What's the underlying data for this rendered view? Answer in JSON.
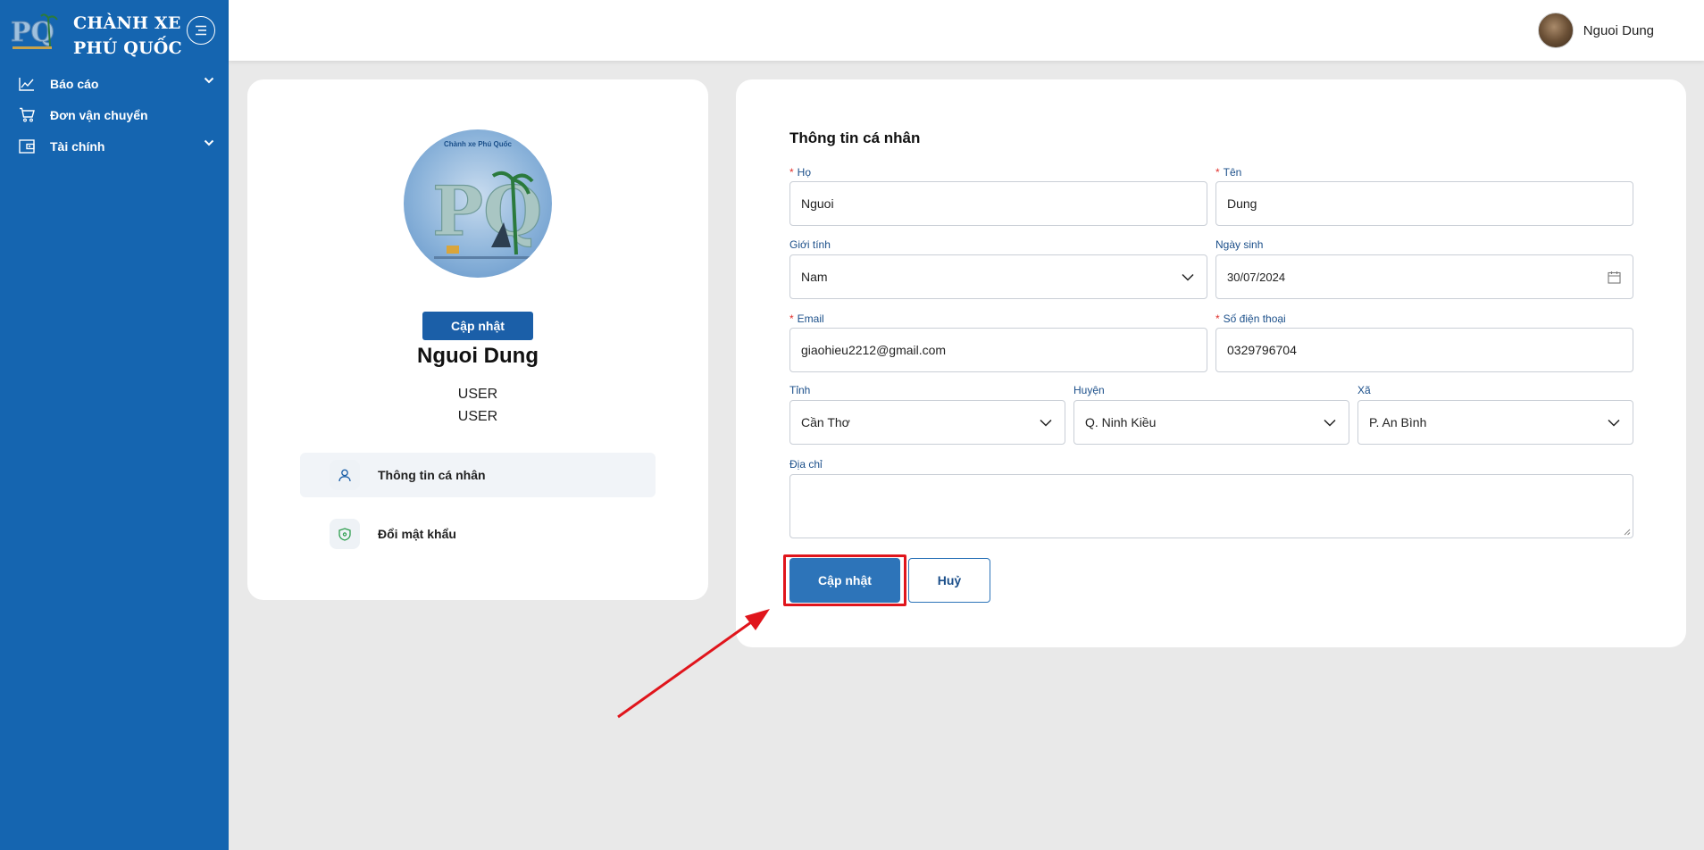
{
  "brand": {
    "name_line1": "CHÀNH XE",
    "name_line2": "PHÚ QUỐC",
    "logo_text": "PQ"
  },
  "sidebar": {
    "items": [
      {
        "label": "Báo cáo",
        "icon": "line-chart-icon",
        "has_submenu": true
      },
      {
        "label": "Đơn vận chuyển",
        "icon": "cart-icon",
        "has_submenu": false
      },
      {
        "label": "Tài chính",
        "icon": "wallet-icon",
        "has_submenu": true
      }
    ]
  },
  "header": {
    "user_name": "Nguoi Dung"
  },
  "profile": {
    "avatar_caption": "Chành xe Phú Quốc",
    "update_label": "Cập nhật",
    "name": "Nguoi Dung",
    "role_1": "USER",
    "role_2": "USER",
    "menu": [
      {
        "label": "Thông tin cá nhân",
        "icon": "user-icon",
        "active": true
      },
      {
        "label": "Đổi mật khẩu",
        "icon": "shield-icon",
        "active": false
      }
    ]
  },
  "form": {
    "title": "Thông tin cá nhân",
    "ho": {
      "label": "Họ",
      "value": "Nguoi"
    },
    "ten": {
      "label": "Tên",
      "value": "Dung"
    },
    "gioi_tinh": {
      "label": "Giới tính",
      "value": "Nam"
    },
    "ngay_sinh": {
      "label": "Ngày sinh",
      "value": "30/07/2024"
    },
    "email": {
      "label": "Email",
      "value": "giaohieu2212@gmail.com"
    },
    "sdt": {
      "label": "Số điện thoại",
      "value": "0329796704"
    },
    "tinh": {
      "label": "Tỉnh",
      "value": "Cần Thơ"
    },
    "huyen": {
      "label": "Huyện",
      "value": "Q. Ninh Kiều"
    },
    "xa": {
      "label": "Xã",
      "value": "P. An Bình"
    },
    "dia_chi": {
      "label": "Địa chỉ",
      "value": ""
    },
    "submit_label": "Cập nhật",
    "cancel_label": "Huỷ"
  },
  "colors": {
    "sidebar": "#1565b0",
    "primary": "#2d74b9",
    "required": "#e0302c",
    "highlight": "#e0151c"
  }
}
